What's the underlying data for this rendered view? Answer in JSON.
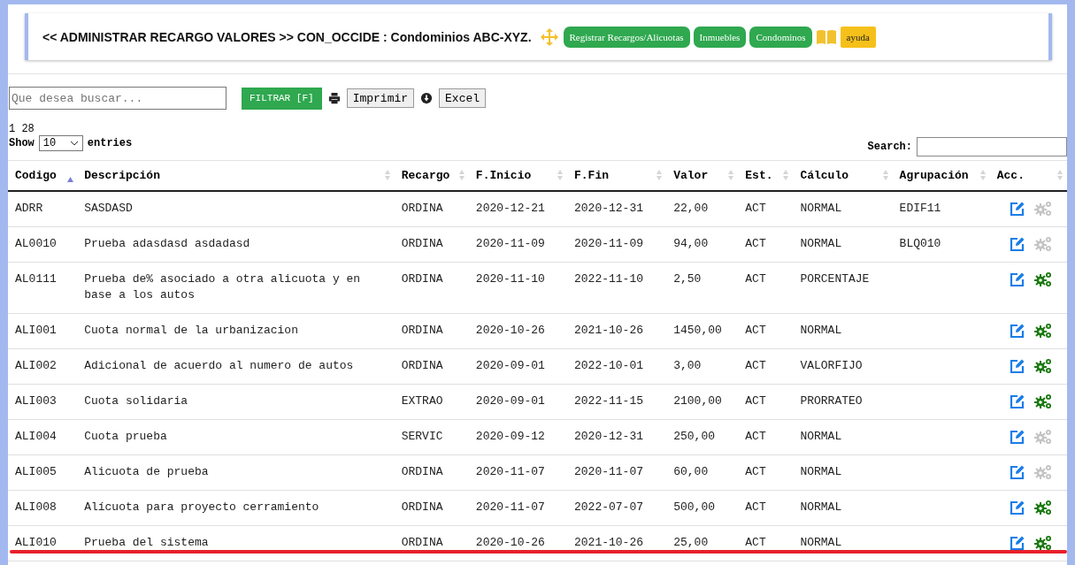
{
  "header": {
    "title": "<< ADMINISTRAR RECARGO VALORES >> CON_OCCIDE : Condominios ABC-XYZ.",
    "buttons": [
      {
        "label": "Registrar Recargos/Alicuotas",
        "kind": "green"
      },
      {
        "label": "Inmuebles",
        "kind": "green"
      },
      {
        "label": "Condominos",
        "kind": "green"
      },
      {
        "label": "ayuda",
        "kind": "help"
      }
    ]
  },
  "toolbar": {
    "search_placeholder": "Que desea buscar...",
    "filter_button": "FILTRAR [F]",
    "print_button": "Imprimir",
    "excel_button": "Excel"
  },
  "pagination": "1 28",
  "length": {
    "show": "Show",
    "value": "10",
    "entries": "entries"
  },
  "search": {
    "label": "Search:"
  },
  "table": {
    "columns": [
      {
        "label": "Codigo",
        "sorted": true
      },
      {
        "label": "Descripción",
        "sorted": false
      },
      {
        "label": "Recargo",
        "sorted": false
      },
      {
        "label": "F.Inicio",
        "sorted": false
      },
      {
        "label": "F.Fin",
        "sorted": false
      },
      {
        "label": "Valor",
        "sorted": false
      },
      {
        "label": "Est.",
        "sorted": false
      },
      {
        "label": "Cálculo",
        "sorted": false
      },
      {
        "label": "Agrupación",
        "sorted": false
      },
      {
        "label": "Acc.",
        "sorted": false
      }
    ],
    "rows": [
      {
        "cells": [
          "ADRR",
          "SASDASD",
          "ORDINA",
          "2020-12-21",
          "2020-12-31",
          "22,00",
          "ACT",
          "NORMAL",
          "EDIF11"
        ],
        "config_enabled": false
      },
      {
        "cells": [
          "AL0010",
          "Prueba adasdasd asdadasd",
          "ORDINA",
          "2020-11-09",
          "2020-11-09",
          "94,00",
          "ACT",
          "NORMAL",
          "BLQ010"
        ],
        "config_enabled": false
      },
      {
        "cells": [
          "AL0111",
          "Prueba de% asociado a otra alicuota y en base a los autos",
          "ORDINA",
          "2020-11-10",
          "2022-11-10",
          "2,50",
          "ACT",
          "PORCENTAJE",
          ""
        ],
        "config_enabled": true
      },
      {
        "cells": [
          "ALI001",
          "Cuota normal de la urbanizacion",
          "ORDINA",
          "2020-10-26",
          "2021-10-26",
          "1450,00",
          "ACT",
          "NORMAL",
          ""
        ],
        "config_enabled": true
      },
      {
        "cells": [
          "ALI002",
          "Adicional de acuerdo al numero de autos",
          "ORDINA",
          "2020-09-01",
          "2022-10-01",
          "3,00",
          "ACT",
          "VALORFIJO",
          ""
        ],
        "config_enabled": true
      },
      {
        "cells": [
          "ALI003",
          "Cuota solidaria",
          "EXTRAO",
          "2020-09-01",
          "2022-11-15",
          "2100,00",
          "ACT",
          "PRORRATEO",
          ""
        ],
        "config_enabled": true
      },
      {
        "cells": [
          "ALI004",
          "Cuota prueba",
          "SERVIC",
          "2020-09-12",
          "2020-12-31",
          "250,00",
          "ACT",
          "NORMAL",
          ""
        ],
        "config_enabled": false
      },
      {
        "cells": [
          "ALI005",
          "Alicuota de prueba",
          "ORDINA",
          "2020-11-07",
          "2020-11-07",
          "60,00",
          "ACT",
          "NORMAL",
          ""
        ],
        "config_enabled": false
      },
      {
        "cells": [
          "ALI008",
          "Alícuota para proyecto cerramiento",
          "ORDINA",
          "2020-11-07",
          "2022-07-07",
          "500,00",
          "ACT",
          "NORMAL",
          ""
        ],
        "config_enabled": true
      },
      {
        "cells": [
          "ALI010",
          "Prueba del sistema",
          "ORDINA",
          "2020-10-26",
          "2021-10-26",
          "25,00",
          "ACT",
          "NORMAL",
          ""
        ],
        "config_enabled": true
      }
    ]
  }
}
